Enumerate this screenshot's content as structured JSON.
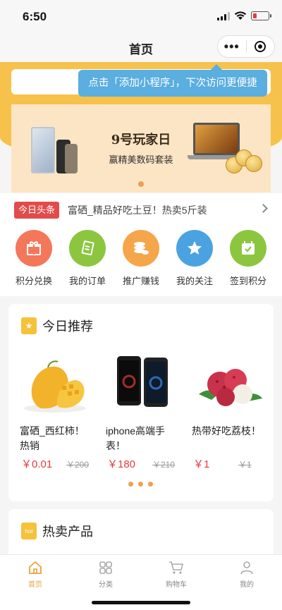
{
  "status": {
    "time": "6:50"
  },
  "navbar": {
    "title": "首页",
    "more_glyph": "•••"
  },
  "tooltip": {
    "text": "点击「添加小程序」，下次访问更便捷"
  },
  "banner": {
    "title": "9号玩家日",
    "subtitle": "赢精美数码套装"
  },
  "headline": {
    "tag": "今日头条",
    "text": "富硒_精品好吃土豆！热卖5斤装"
  },
  "categories": [
    {
      "label": "积分兑换",
      "icon": "gift-icon",
      "color": "#f4775a"
    },
    {
      "label": "我的订单",
      "icon": "order-icon",
      "color": "#8cc63f"
    },
    {
      "label": "推广赚钱",
      "icon": "coins-icon",
      "color": "#f5a64a"
    },
    {
      "label": "我的关注",
      "icon": "star-icon",
      "color": "#4aa3e0"
    },
    {
      "label": "签到积分",
      "icon": "calendar-check-icon",
      "color": "#8cc63f"
    }
  ],
  "recommend": {
    "title": "今日推荐",
    "products": [
      {
        "name": "富硒_西红柿！热销",
        "price": "￥0.01",
        "old_price": "￥200"
      },
      {
        "name": "iphone高端手表！",
        "price": "￥180",
        "old_price": "￥210"
      },
      {
        "name": "热带好吃荔枝！",
        "price": "￥1",
        "old_price": "￥1"
      }
    ]
  },
  "hot": {
    "badge": "hot",
    "title": "热卖产品"
  },
  "tabs": [
    {
      "label": "首页",
      "icon": "home-icon",
      "active": true
    },
    {
      "label": "分类",
      "icon": "grid-icon",
      "active": false
    },
    {
      "label": "购物车",
      "icon": "cart-icon",
      "active": false
    },
    {
      "label": "我的",
      "icon": "user-icon",
      "active": false
    }
  ],
  "colors": {
    "accent": "#f7c24b",
    "price": "#e23c3c",
    "tooltip": "#5aaee0",
    "active_tab": "#e8a33a"
  }
}
